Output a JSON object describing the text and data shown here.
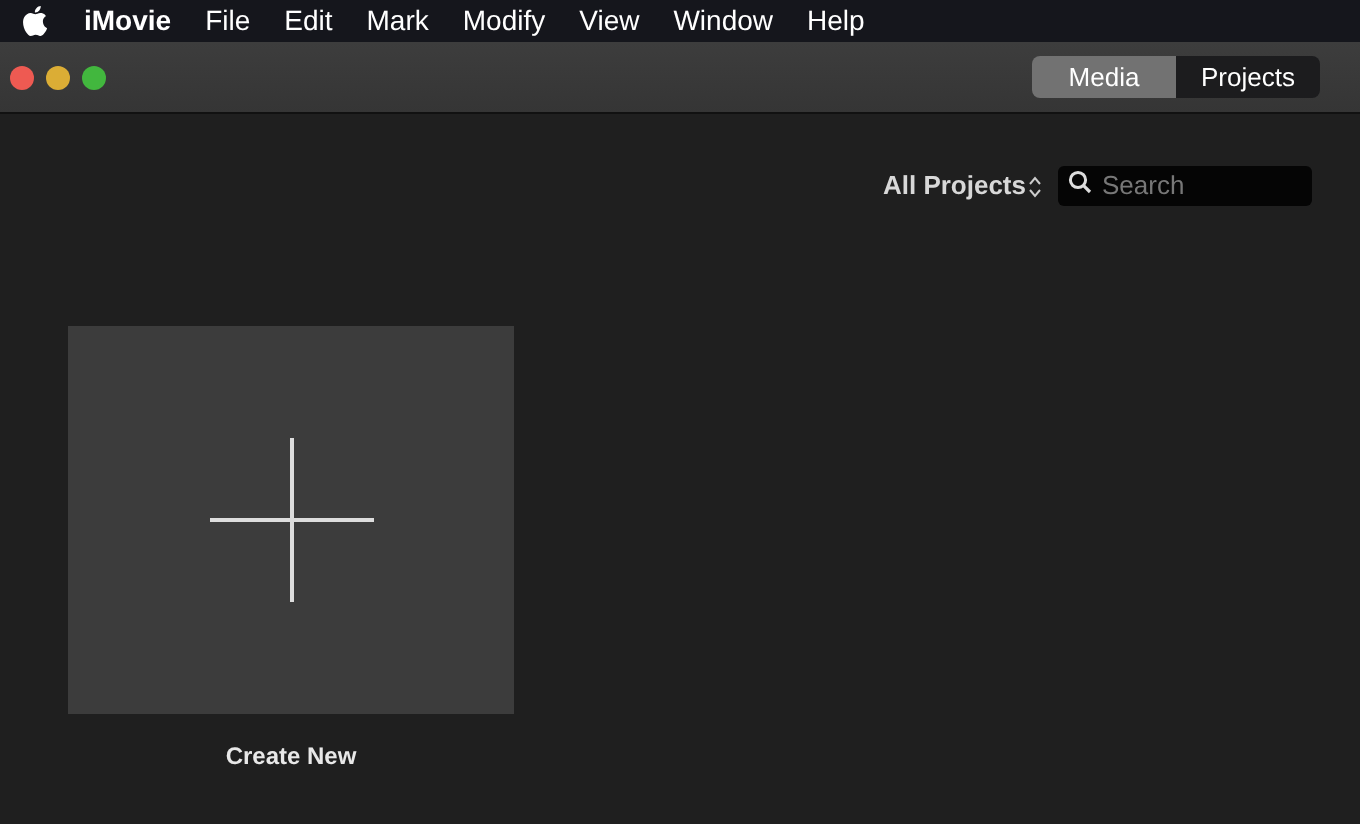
{
  "menu_bar": {
    "items": [
      {
        "label": "iMovie",
        "bold": true
      },
      {
        "label": "File",
        "bold": false
      },
      {
        "label": "Edit",
        "bold": false
      },
      {
        "label": "Mark",
        "bold": false
      },
      {
        "label": "Modify",
        "bold": false
      },
      {
        "label": "View",
        "bold": false
      },
      {
        "label": "Window",
        "bold": false
      },
      {
        "label": "Help",
        "bold": false
      }
    ]
  },
  "tabs": [
    {
      "label": "Media",
      "selected": false
    },
    {
      "label": "Projects",
      "selected": true
    }
  ],
  "filter": {
    "label": "All Projects"
  },
  "search": {
    "placeholder": "Search"
  },
  "tiles": [
    {
      "label": "Create New"
    }
  ]
}
